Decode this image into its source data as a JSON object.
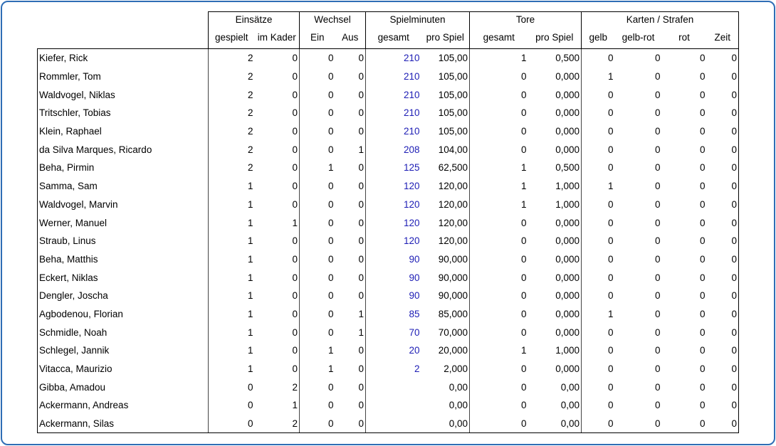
{
  "groups": {
    "einsaetze": "Einsätze",
    "wechsel": "Wechsel",
    "spielminuten": "Spielminuten",
    "tore": "Tore",
    "karten": "Karten / Strafen"
  },
  "subheaders": [
    "gespielt",
    "im Kader",
    "Ein",
    "Aus",
    "gesamt",
    "pro Spiel",
    "gesamt",
    "pro Spiel",
    "gelb",
    "gelb-rot",
    "rot",
    "Zeit"
  ],
  "rows": [
    [
      "Kiefer, Rick",
      "2",
      "0",
      "0",
      "0",
      "210",
      "105,00",
      "1",
      "0,500",
      "0",
      "0",
      "0",
      "0"
    ],
    [
      "Rommler, Tom",
      "2",
      "0",
      "0",
      "0",
      "210",
      "105,00",
      "0",
      "0,000",
      "1",
      "0",
      "0",
      "0"
    ],
    [
      "Waldvogel, Niklas",
      "2",
      "0",
      "0",
      "0",
      "210",
      "105,00",
      "0",
      "0,000",
      "0",
      "0",
      "0",
      "0"
    ],
    [
      "Tritschler, Tobias",
      "2",
      "0",
      "0",
      "0",
      "210",
      "105,00",
      "0",
      "0,000",
      "0",
      "0",
      "0",
      "0"
    ],
    [
      "Klein, Raphael",
      "2",
      "0",
      "0",
      "0",
      "210",
      "105,00",
      "0",
      "0,000",
      "0",
      "0",
      "0",
      "0"
    ],
    [
      "da Silva Marques, Ricardo",
      "2",
      "0",
      "0",
      "1",
      "208",
      "104,00",
      "0",
      "0,000",
      "0",
      "0",
      "0",
      "0"
    ],
    [
      "Beha, Pirmin",
      "2",
      "0",
      "1",
      "0",
      "125",
      "62,500",
      "1",
      "0,500",
      "0",
      "0",
      "0",
      "0"
    ],
    [
      "Samma, Sam",
      "1",
      "0",
      "0",
      "0",
      "120",
      "120,00",
      "1",
      "1,000",
      "1",
      "0",
      "0",
      "0"
    ],
    [
      "Waldvogel, Marvin",
      "1",
      "0",
      "0",
      "0",
      "120",
      "120,00",
      "1",
      "1,000",
      "0",
      "0",
      "0",
      "0"
    ],
    [
      "Werner, Manuel",
      "1",
      "1",
      "0",
      "0",
      "120",
      "120,00",
      "0",
      "0,000",
      "0",
      "0",
      "0",
      "0"
    ],
    [
      "Straub, Linus",
      "1",
      "0",
      "0",
      "0",
      "120",
      "120,00",
      "0",
      "0,000",
      "0",
      "0",
      "0",
      "0"
    ],
    [
      "Beha, Matthis",
      "1",
      "0",
      "0",
      "0",
      "90",
      "90,000",
      "0",
      "0,000",
      "0",
      "0",
      "0",
      "0"
    ],
    [
      "Eckert, Niklas",
      "1",
      "0",
      "0",
      "0",
      "90",
      "90,000",
      "0",
      "0,000",
      "0",
      "0",
      "0",
      "0"
    ],
    [
      "Dengler, Joscha",
      "1",
      "0",
      "0",
      "0",
      "90",
      "90,000",
      "0",
      "0,000",
      "0",
      "0",
      "0",
      "0"
    ],
    [
      "Agbodenou, Florian",
      "1",
      "0",
      "0",
      "1",
      "85",
      "85,000",
      "0",
      "0,000",
      "1",
      "0",
      "0",
      "0"
    ],
    [
      "Schmidle, Noah",
      "1",
      "0",
      "0",
      "1",
      "70",
      "70,000",
      "0",
      "0,000",
      "0",
      "0",
      "0",
      "0"
    ],
    [
      "Schlegel, Jannik",
      "1",
      "0",
      "1",
      "0",
      "20",
      "20,000",
      "1",
      "1,000",
      "0",
      "0",
      "0",
      "0"
    ],
    [
      "Vitacca, Maurizio",
      "1",
      "0",
      "1",
      "0",
      "2",
      "2,000",
      "0",
      "0,000",
      "0",
      "0",
      "0",
      "0"
    ],
    [
      "Gibba, Amadou",
      "0",
      "2",
      "0",
      "0",
      "",
      "0,00",
      "0",
      "0,00",
      "0",
      "0",
      "0",
      "0"
    ],
    [
      "Ackermann, Andreas",
      "0",
      "1",
      "0",
      "0",
      "",
      "0,00",
      "0",
      "0,00",
      "0",
      "0",
      "0",
      "0"
    ],
    [
      "Ackermann, Silas",
      "0",
      "2",
      "0",
      "0",
      "",
      "0,00",
      "0",
      "0,00",
      "0",
      "0",
      "0",
      "0"
    ]
  ],
  "colors": {
    "frame": "#2f6db5",
    "minutes": "#1d1db5"
  }
}
